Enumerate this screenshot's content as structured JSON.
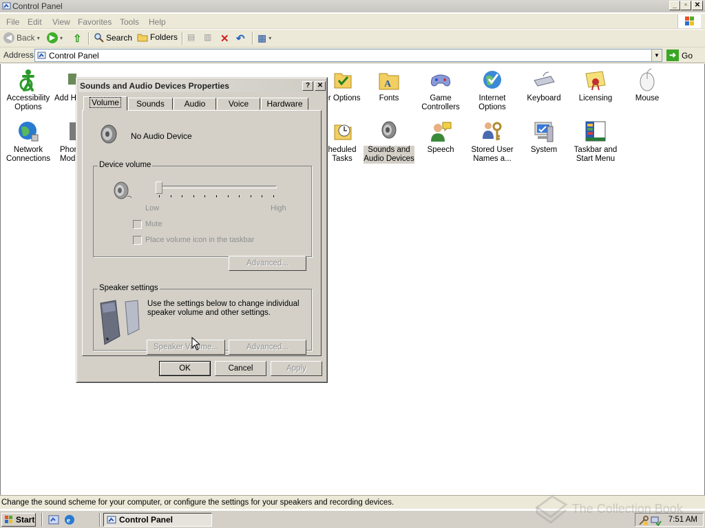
{
  "window": {
    "title": "Control Panel"
  },
  "menu": [
    "File",
    "Edit",
    "View",
    "Favorites",
    "Tools",
    "Help"
  ],
  "toolbar": {
    "back": "Back",
    "search": "Search",
    "folders": "Folders"
  },
  "address": {
    "label": "Address",
    "value": "Control Panel",
    "go": "Go"
  },
  "items": [
    {
      "label": "Accessibility Options",
      "icon": "accessibility-icon"
    },
    {
      "label": "Add H",
      "icon": "add-hardware-icon"
    },
    {
      "label": "er Options",
      "icon": "folder-options-icon"
    },
    {
      "label": "Fonts",
      "icon": "fonts-icon"
    },
    {
      "label": "Game Controllers",
      "icon": "game-controllers-icon"
    },
    {
      "label": "Internet Options",
      "icon": "internet-options-icon"
    },
    {
      "label": "Keyboard",
      "icon": "keyboard-icon"
    },
    {
      "label": "Licensing",
      "icon": "licensing-icon"
    },
    {
      "label": "Mouse",
      "icon": "mouse-icon"
    },
    {
      "label": "Network Connections",
      "icon": "network-icon"
    },
    {
      "label": "Phon Mod",
      "icon": "phone-modem-icon"
    },
    {
      "label": "heduled Tasks",
      "icon": "scheduled-tasks-icon"
    },
    {
      "label": "Sounds and Audio Devices",
      "icon": "sound-icon"
    },
    {
      "label": "Speech",
      "icon": "speech-icon"
    },
    {
      "label": "Stored User Names a...",
      "icon": "stored-users-icon"
    },
    {
      "label": "System",
      "icon": "system-icon"
    },
    {
      "label": "Taskbar and Start Menu",
      "icon": "taskbar-icon"
    }
  ],
  "status": "Change the sound scheme for your computer, or configure the settings for your speakers and recording devices.",
  "taskbar": {
    "start": "Start",
    "task": "Control Panel",
    "clock": "7:51 AM"
  },
  "watermark": "The Collection Book",
  "dialog": {
    "title": "Sounds and Audio Devices Properties",
    "tabs": [
      "Volume",
      "Sounds",
      "Audio",
      "Voice",
      "Hardware"
    ],
    "device_name": "No Audio Device",
    "device_volume_group": "Device volume",
    "low": "Low",
    "high": "High",
    "volume_level": 0,
    "mute": "Mute",
    "place_icon": "Place volume icon in the taskbar",
    "advanced": "Advanced...",
    "speaker_group": "Speaker settings",
    "speaker_text": "Use the settings below to change individual speaker volume and other settings.",
    "speaker_volume": "Speaker Volume...",
    "ok": "OK",
    "cancel": "Cancel",
    "apply": "Apply"
  }
}
